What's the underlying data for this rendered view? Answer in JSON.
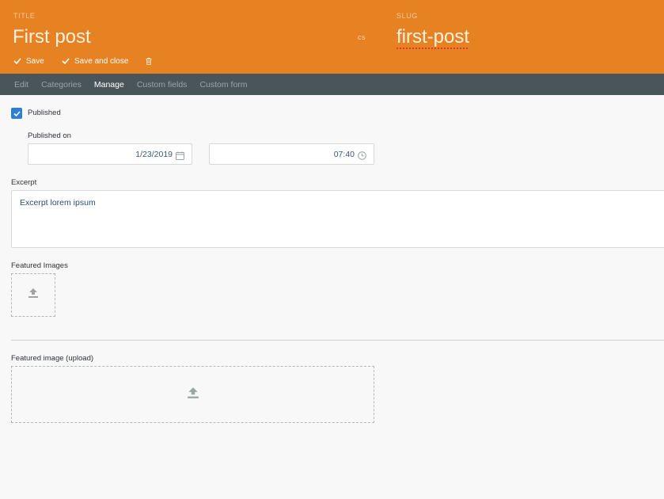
{
  "header": {
    "title_label": "TITLE",
    "title_value": "First post",
    "language": "cs",
    "slug_label": "SLUG",
    "slug_value": "first-post",
    "save_label": "Save",
    "save_close_label": "Save and close",
    "accent_color": "#e68222"
  },
  "tabs": [
    {
      "label": "Edit",
      "active": false
    },
    {
      "label": "Categories",
      "active": false
    },
    {
      "label": "Manage",
      "active": true
    },
    {
      "label": "Custom fields",
      "active": false
    },
    {
      "label": "Custom form",
      "active": false
    }
  ],
  "form": {
    "published_label": "Published",
    "published_checked": true,
    "published_on_label": "Published on",
    "date_value": "1/23/2019",
    "time_value": "07:40",
    "excerpt_label": "Excerpt",
    "excerpt_value": "Excerpt lorem ipsum",
    "featured_images_label": "Featured Images",
    "featured_upload_label": "Featured image (upload)"
  },
  "icons": [
    "check-icon",
    "trash-icon",
    "calendar-icon",
    "clock-icon",
    "upload-icon"
  ]
}
